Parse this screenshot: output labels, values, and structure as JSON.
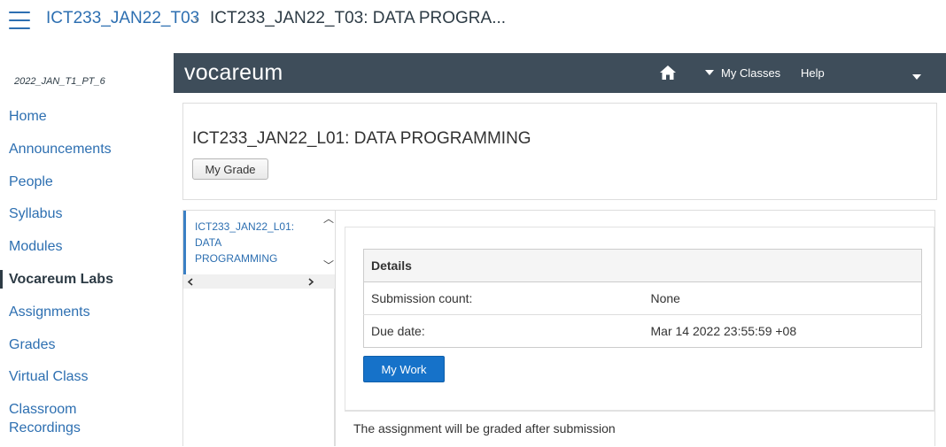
{
  "breadcrumb": {
    "parent": "ICT233_JAN22_T03",
    "separator": "›",
    "current": "ICT233_JAN22_T03: DATA PROGRA..."
  },
  "sidebar": {
    "course_code": "2022_JAN_T1_PT_6",
    "items": [
      {
        "label": "Home"
      },
      {
        "label": "Announcements"
      },
      {
        "label": "People"
      },
      {
        "label": "Syllabus"
      },
      {
        "label": "Modules"
      },
      {
        "label": "Vocareum Labs"
      },
      {
        "label": "Assignments"
      },
      {
        "label": "Grades"
      },
      {
        "label": "Virtual Class"
      },
      {
        "label": "Classroom Recordings"
      }
    ]
  },
  "vocareum": {
    "logo": "vocareum",
    "menu": {
      "my_classes": "My Classes",
      "help": "Help"
    },
    "course_title": "ICT233_JAN22_L01: DATA PROGRAMMING",
    "my_grade_label": "My Grade",
    "assignment": "ICT233_JAN22_L01: DATA PROGRAMMING",
    "details": {
      "header": "Details",
      "rows": [
        {
          "label": "Submission count:",
          "value": "None"
        },
        {
          "label": "Due date:",
          "value": "Mar 14 2022 23:55:59 +08"
        }
      ]
    },
    "my_work_label": "My Work",
    "grade_note": "The assignment will be graded after submission"
  },
  "colors": {
    "link": "#2d6fb1",
    "header_bg": "#3e4d5a",
    "button_primary": "#1672c9"
  }
}
